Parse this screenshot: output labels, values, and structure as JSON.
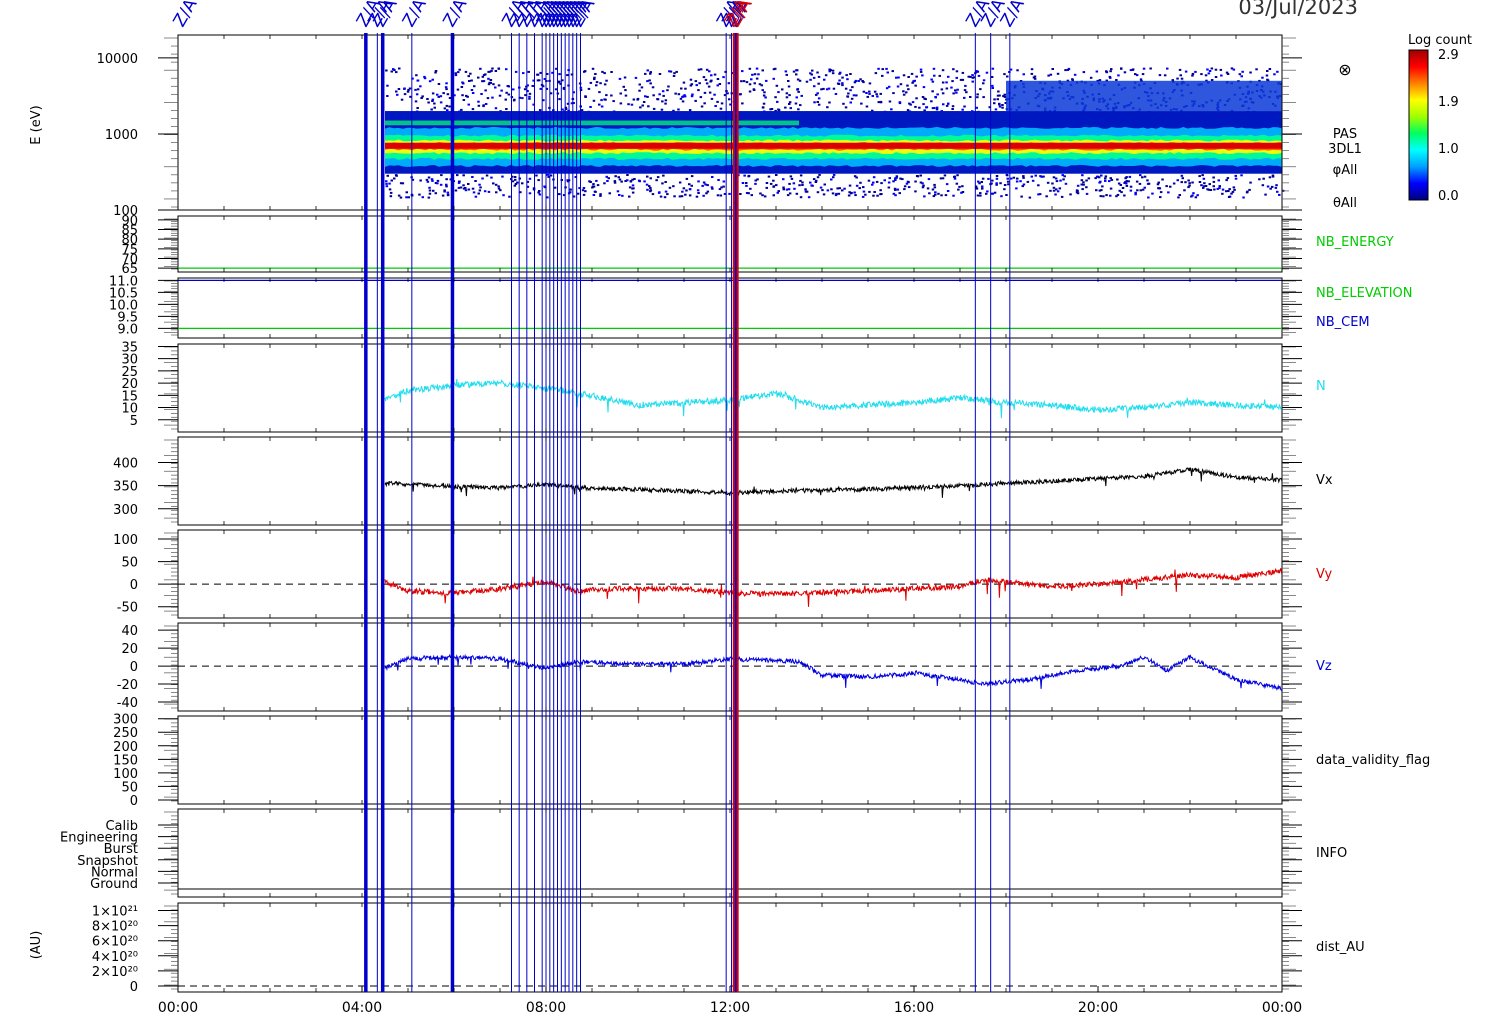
{
  "header": {
    "date": "03/Jul/2023"
  },
  "colorbar": {
    "title": "Log count",
    "ticks": [
      "2.9",
      "1.9",
      "1.0",
      "0.0"
    ],
    "gradient": [
      "#000080",
      "#0000ff",
      "#00a0ff",
      "#00ffff",
      "#00ff60",
      "#a0ff00",
      "#ffff00",
      "#ff8000",
      "#ff0000",
      "#a00000"
    ]
  },
  "event_markers": {
    "label": "Z/A",
    "thick": [
      "04:05",
      "04:27",
      "05:58",
      "12:08"
    ],
    "thin": [
      "04:20",
      "05:05",
      "07:15",
      "07:25",
      "07:35",
      "07:45",
      "07:55",
      "08:00",
      "08:05",
      "08:10",
      "08:15",
      "08:20",
      "08:25",
      "08:30",
      "08:35",
      "08:40",
      "08:45",
      "11:55",
      "12:02",
      "17:20",
      "17:40",
      "18:05"
    ],
    "red": [
      "12:05",
      "12:10"
    ],
    "colors": {
      "blue": "#0000cc",
      "red": "#dd0000"
    }
  },
  "chart_data": [
    {
      "type": "heatmap",
      "id": "energy",
      "ylabel": "E (eV)",
      "scale": "log",
      "ylim": [
        100,
        20000
      ],
      "yticks": [
        "10000",
        "1000",
        "100"
      ],
      "side_labels": [
        "PAS",
        "3DL1",
        "φAll",
        "θAll"
      ],
      "rows": [
        {
          "e_min": 150,
          "e_max": 7500,
          "coverage": "04:30-24:00",
          "dominant_band_eV": 700,
          "log_count_peak": 2.9
        },
        {
          "e_min": 1300,
          "e_max": 1500,
          "coverage": "04:30-13:30",
          "log_count_peak": 1.6
        }
      ]
    },
    {
      "type": "line",
      "id": "nb",
      "yticks": [
        "90",
        "85",
        "80",
        "75",
        "70",
        "65"
      ],
      "ylim": [
        63,
        92
      ],
      "series": [
        {
          "name": "NB_ENERGY",
          "color": "#00cc00",
          "value": 65
        }
      ]
    },
    {
      "type": "line",
      "id": "elev",
      "yticks": [
        "11.0",
        "10.5",
        "10.0",
        "9.5",
        "9.0"
      ],
      "ylim": [
        8.6,
        11.1
      ],
      "series": [
        {
          "name": "NB_ELEVATION",
          "color": "#00cc00",
          "value": 9.0
        },
        {
          "name": "NB_CEM",
          "color": "#0000cc",
          "value": 11.0
        }
      ]
    },
    {
      "type": "line",
      "id": "density",
      "yticks": [
        "35",
        "30",
        "25",
        "20",
        "15",
        "10",
        "5"
      ],
      "ylim": [
        0,
        36
      ],
      "series": [
        {
          "name": "N",
          "color": "#22ddee",
          "x": [
            "04:30",
            "05:00",
            "06:00",
            "07:00",
            "08:00",
            "08:40",
            "09:30",
            "10:00",
            "11:00",
            "12:00",
            "13:00",
            "14:00",
            "15:00",
            "16:00",
            "17:00",
            "18:00",
            "19:00",
            "20:00",
            "21:00",
            "22:00",
            "23:00",
            "24:00"
          ],
          "y": [
            13,
            17,
            19,
            20,
            18,
            16,
            13,
            11,
            12,
            13,
            16,
            10,
            11,
            12,
            14,
            12,
            11,
            9,
            10,
            12,
            11,
            10
          ]
        }
      ]
    },
    {
      "type": "line",
      "id": "vx",
      "yticks": [
        "400",
        "350",
        "300"
      ],
      "ylim": [
        265,
        455
      ],
      "series": [
        {
          "name": "Vx",
          "color": "#000000",
          "x": [
            "04:30",
            "06:00",
            "07:00",
            "08:00",
            "09:00",
            "10:00",
            "11:00",
            "12:00",
            "13:00",
            "14:00",
            "15:00",
            "16:00",
            "17:00",
            "18:00",
            "19:00",
            "20:00",
            "21:00",
            "22:00",
            "23:00",
            "24:00"
          ],
          "y": [
            355,
            348,
            345,
            352,
            344,
            342,
            338,
            335,
            338,
            340,
            342,
            346,
            350,
            355,
            360,
            365,
            370,
            385,
            368,
            362
          ]
        }
      ]
    },
    {
      "type": "line",
      "id": "vy",
      "yticks": [
        "100",
        "50",
        "0",
        "-50"
      ],
      "ylim": [
        -75,
        120
      ],
      "zero_line": true,
      "series": [
        {
          "name": "Vy",
          "color": "#dd0000",
          "x": [
            "04:30",
            "05:00",
            "06:00",
            "07:00",
            "08:00",
            "08:40",
            "09:30",
            "11:00",
            "12:00",
            "13:00",
            "14:00",
            "15:00",
            "16:00",
            "17:00",
            "17:30",
            "18:00",
            "19:00",
            "20:00",
            "21:00",
            "22:00",
            "23:00",
            "24:00"
          ],
          "y": [
            5,
            -15,
            -20,
            -10,
            5,
            -15,
            -10,
            -10,
            -20,
            -22,
            -18,
            -15,
            -10,
            -5,
            10,
            5,
            -5,
            0,
            10,
            20,
            15,
            30
          ]
        }
      ]
    },
    {
      "type": "line",
      "id": "vz",
      "yticks": [
        "40",
        "20",
        "0",
        "-20",
        "-40"
      ],
      "ylim": [
        -50,
        48
      ],
      "zero_line": true,
      "series": [
        {
          "name": "Vz",
          "color": "#0000dd",
          "x": [
            "04:30",
            "05:00",
            "06:00",
            "07:00",
            "08:00",
            "08:40",
            "09:30",
            "11:00",
            "12:00",
            "13:30",
            "14:00",
            "15:00",
            "16:00",
            "17:00",
            "17:30",
            "18:30",
            "19:30",
            "20:30",
            "21:00",
            "21:30",
            "22:00",
            "23:00",
            "24:00"
          ],
          "y": [
            -2,
            8,
            10,
            8,
            -2,
            5,
            3,
            2,
            8,
            5,
            -10,
            -12,
            -8,
            -15,
            -20,
            -15,
            -5,
            0,
            10,
            -5,
            10,
            -15,
            -25
          ]
        }
      ]
    },
    {
      "type": "line",
      "id": "dvf",
      "yticks": [
        "300",
        "250",
        "200",
        "150",
        "100",
        "50",
        "0"
      ],
      "ylim": [
        -15,
        310
      ],
      "series": [
        {
          "name": "data_validity_flag"
        }
      ]
    },
    {
      "type": "line",
      "id": "info",
      "yticks": [
        "Calib",
        "Engineering",
        "Burst",
        "Snapshot",
        "Normal",
        "Ground"
      ],
      "series": [
        {
          "name": "INFO"
        }
      ]
    },
    {
      "type": "line",
      "id": "dist",
      "ylabel": "(AU)",
      "yticks": [
        "1×10²¹",
        "8×10²⁰",
        "6×10²⁰",
        "4×10²⁰",
        "2×10²⁰",
        "0"
      ],
      "ylim": [
        -0.08,
        1.1
      ],
      "zero_line": true,
      "series": [
        {
          "name": "dist_AU"
        }
      ]
    }
  ],
  "x_axis": {
    "range_hours": [
      0,
      24
    ],
    "ticks": [
      "00:00",
      "04:00",
      "08:00",
      "12:00",
      "16:00",
      "20:00",
      "00:00"
    ]
  }
}
